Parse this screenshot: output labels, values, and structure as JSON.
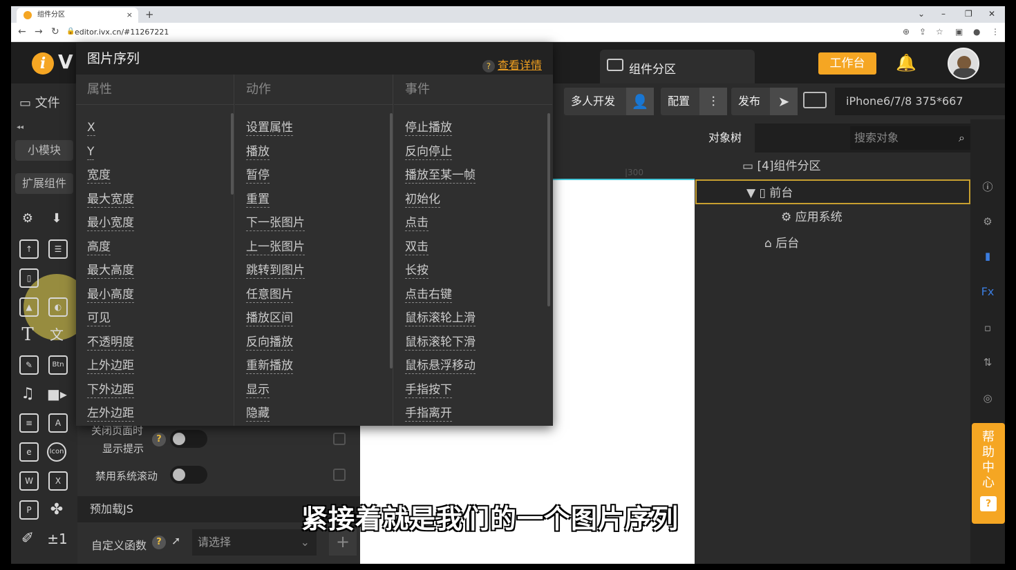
{
  "browser": {
    "tab_title": "组件分区",
    "url": "editor.ivx.cn/#11267221",
    "new_tab": "+",
    "tab_close": "×"
  },
  "header": {
    "logo_text": "i",
    "logo_text2": "V",
    "component_tab": "组件分区",
    "workbench": "工作台"
  },
  "toolbar": {
    "file": "文件",
    "multi_dev": "多人开发",
    "config": "配置",
    "publish": "发布",
    "device": "iPhone6/7/8 375*667"
  },
  "left": {
    "collapse": "◂◂",
    "small_module": "小模块",
    "extend_component": "扩展组件",
    "icons": [
      "gear-icon",
      "download-icon",
      "upload-icon",
      "layout-icon",
      "copy-icon",
      "image-icon",
      "image-sequence-icon",
      "text-icon",
      "translate-icon",
      "edit-icon",
      "button-icon",
      "music-icon",
      "video-icon",
      "richtext-icon",
      "textarea-icon",
      "iframe-icon",
      "icon-component-icon",
      "word-icon",
      "excel-icon",
      "ppt-icon",
      "gallery-icon",
      "formula-icon",
      "counter-icon"
    ],
    "btn_text": "Btn",
    "icon_text": "Icon",
    "counter_text": "±1"
  },
  "props": {
    "close_hint_line1": "关闭页面时",
    "close_hint_line2": "显示提示",
    "disable_scroll": "禁用系统滚动",
    "preload_js": "预加载JS",
    "custom_func": "自定义函数",
    "select_placeholder": "请选择",
    "plus": "+"
  },
  "ruler_mark": "|300",
  "object_tree": {
    "title": "对象树",
    "search_placeholder": "搜索对象",
    "root": "[4]组件分区",
    "front": "前台",
    "app_system": "应用系统",
    "back": "后台"
  },
  "help_center": "帮助中心",
  "popup": {
    "title": "图片序列",
    "detail_link": "查看详情",
    "columns": [
      {
        "header": "属性",
        "items": [
          "X",
          "Y",
          "宽度",
          "最大宽度",
          "最小宽度",
          "高度",
          "最大高度",
          "最小高度",
          "可见",
          "不透明度",
          "上外边距",
          "下外边距",
          "左外边距"
        ]
      },
      {
        "header": "动作",
        "items": [
          "设置属性",
          "播放",
          "暂停",
          "重置",
          "下一张图片",
          "上一张图片",
          "跳转到图片",
          "任意图片",
          "播放区间",
          "反向播放",
          "重新播放",
          "显示",
          "隐藏"
        ]
      },
      {
        "header": "事件",
        "items": [
          "停止播放",
          "反向停止",
          "播放至某一帧",
          "初始化",
          "点击",
          "双击",
          "长按",
          "点击右键",
          "鼠标滚轮上滑",
          "鼠标滚轮下滑",
          "鼠标悬浮移动",
          "手指按下",
          "手指离开"
        ]
      }
    ]
  },
  "subtitle": "紧接着就是我们的一个图片序列",
  "colors": {
    "accent": "#f5a623",
    "canvas_border": "#43c6d8",
    "selection": "#c8a030"
  }
}
